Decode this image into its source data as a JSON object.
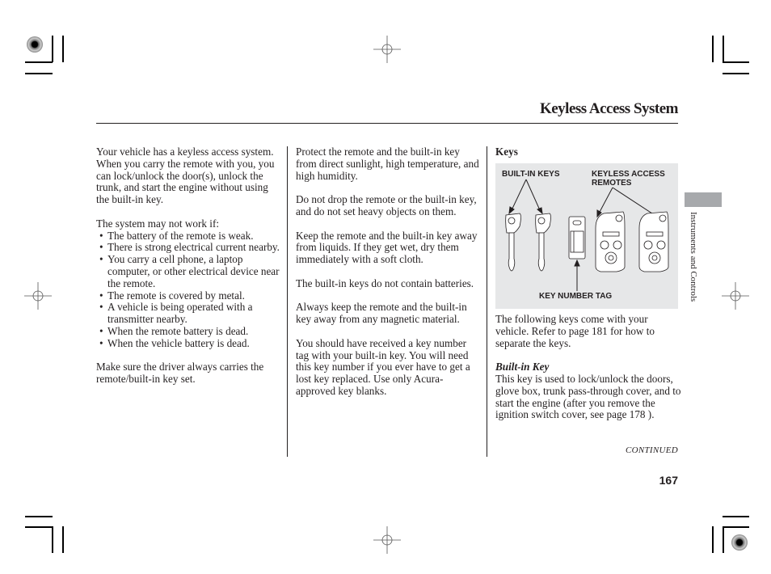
{
  "header": {
    "title": "Keyless Access System"
  },
  "column1": {
    "intro": "Your vehicle has a keyless access system. When you carry the remote with you, you can lock/unlock the door(s), unlock the trunk, and start the engine without using the built-in key.",
    "list_intro": "The system may not work if:",
    "bullets": [
      "The battery of the remote is weak.",
      "There is strong electrical current nearby.",
      "You carry a cell phone, a laptop computer, or other electrical device near the remote.",
      "The remote is covered by metal.",
      "A vehicle is being operated with a transmitter nearby.",
      "When the remote battery is dead.",
      "When the vehicle battery is dead."
    ],
    "closing": "Make sure the driver always carries the remote/built-in key set."
  },
  "column2": {
    "paragraphs": [
      "Protect the remote and the built-in key from direct sunlight, high temperature, and high humidity.",
      "Do not drop the remote or the built-in key, and do not set heavy objects on them.",
      "Keep the remote and the built-in key away from liquids. If they get wet, dry them immediately with a soft cloth.",
      "The built-in keys do not contain batteries.",
      "Always keep the remote and the built-in key away from any magnetic material.",
      "You should have received a key number tag with your built-in key. You will need this key number if you ever have to get a lost key replaced. Use only Acura-approved key blanks."
    ]
  },
  "column3": {
    "heading": "Keys",
    "figure": {
      "label_builtin_keys": "BUILT-IN KEYS",
      "label_remotes_line1": "KEYLESS ACCESS",
      "label_remotes_line2": "REMOTES",
      "label_tag": "KEY NUMBER TAG"
    },
    "intro": "The following keys come with your vehicle. Refer to page 181 for how to separate the keys.",
    "subheading": "Built-in Key",
    "body": "This key is used to lock/unlock the doors, glove box, trunk pass-through cover, and to start the engine (after you remove the ignition switch cover, see page 178 )."
  },
  "sidebar": {
    "section": "Instruments and Controls"
  },
  "footer": {
    "continued": "CONTINUED",
    "page_number": "167"
  },
  "colors": {
    "tab_gray": "#a7a9ac",
    "figure_bg": "#e6e7e8",
    "text": "#231f20"
  }
}
